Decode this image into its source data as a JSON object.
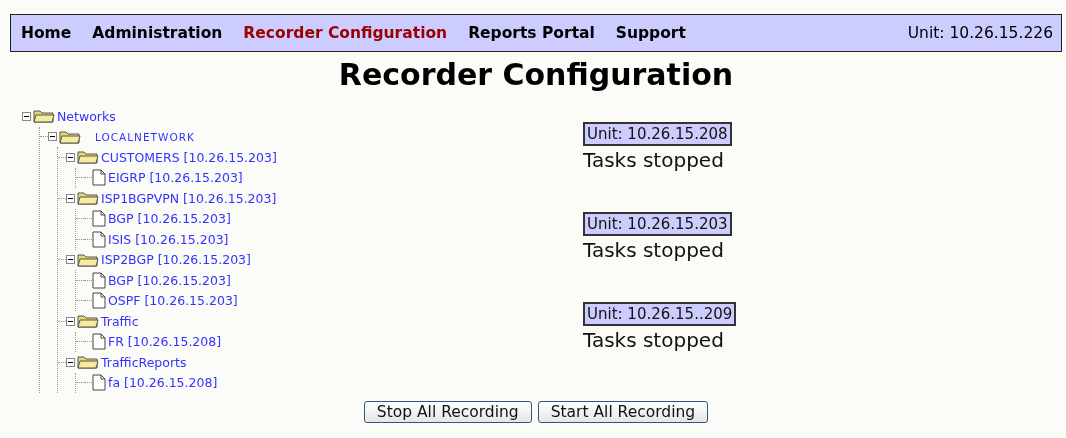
{
  "nav": {
    "items": [
      {
        "label": "Home",
        "selected": false
      },
      {
        "label": "Administration",
        "selected": false
      },
      {
        "label": "Recorder Configuration",
        "selected": true
      },
      {
        "label": "Reports Portal",
        "selected": false
      },
      {
        "label": "Support",
        "selected": false
      }
    ],
    "unit": "Unit: 10.26.15.226"
  },
  "title": "Recorder Configuration",
  "tree": [
    {
      "label": "Networks",
      "kind": "folder",
      "expanded": true,
      "children": [
        {
          "label": "LOCALNETWORK",
          "kind": "folder",
          "expanded": true,
          "children": [
            {
              "label": "CUSTOMERS [10.26.15.203]",
              "kind": "folder",
              "expanded": true,
              "children": [
                {
                  "label": "EIGRP [10.26.15.203]",
                  "kind": "leaf"
                }
              ]
            },
            {
              "label": "ISP1BGPVPN [10.26.15.203]",
              "kind": "folder",
              "expanded": true,
              "children": [
                {
                  "label": "BGP [10.26.15.203]",
                  "kind": "leaf"
                },
                {
                  "label": "ISIS [10.26.15.203]",
                  "kind": "leaf"
                }
              ]
            },
            {
              "label": "ISP2BGP [10.26.15.203]",
              "kind": "folder",
              "expanded": true,
              "children": [
                {
                  "label": "BGP [10.26.15.203]",
                  "kind": "leaf"
                },
                {
                  "label": "OSPF [10.26.15.203]",
                  "kind": "leaf"
                }
              ]
            },
            {
              "label": "Traffic",
              "kind": "folder",
              "expanded": true,
              "children": [
                {
                  "label": "FR [10.26.15.208]",
                  "kind": "leaf"
                }
              ]
            },
            {
              "label": "TrafficReports",
              "kind": "folder",
              "expanded": true,
              "children": [
                {
                  "label": "fa [10.26.15.208]",
                  "kind": "leaf"
                }
              ]
            }
          ]
        }
      ]
    }
  ],
  "units": [
    {
      "unit": "Unit: 10.26.15.208",
      "status": "Tasks stopped"
    },
    {
      "unit": "Unit: 10.26.15.203",
      "status": "Tasks stopped"
    },
    {
      "unit": "Unit: 10.26.15..209",
      "status": "Tasks stopped"
    }
  ],
  "buttons": [
    "Stop All Recording",
    "Start All Recording"
  ]
}
